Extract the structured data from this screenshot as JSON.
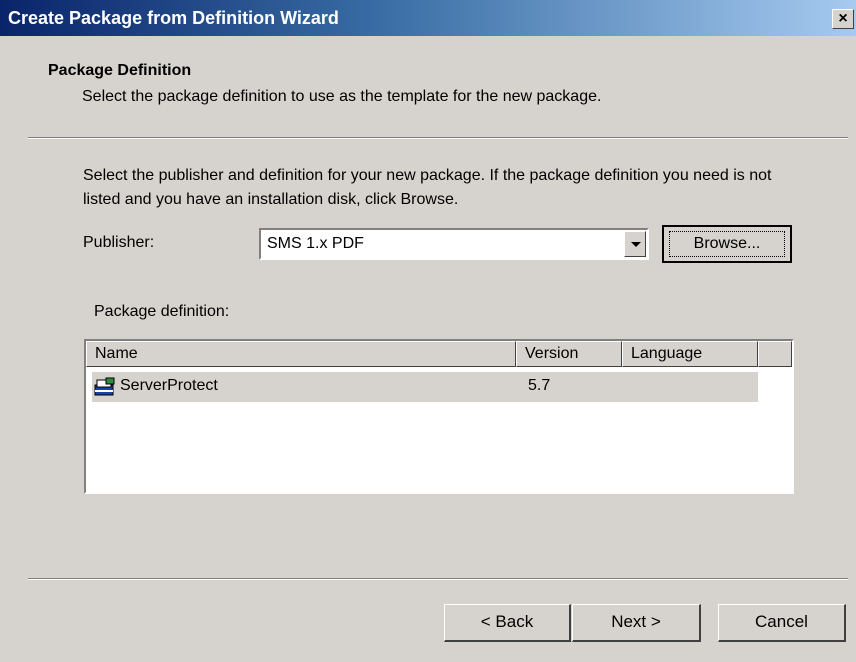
{
  "window": {
    "title": "Create Package from Definition Wizard",
    "close_label": "×"
  },
  "header": {
    "title": "Package Definition",
    "description": "Select the package definition to use as the template for the new package."
  },
  "instructions": "Select the publisher and definition for your new package. If the package definition you need is not listed and you have an installation disk, click Browse.",
  "publisher": {
    "label": "Publisher:",
    "value": "SMS 1.x PDF"
  },
  "browse_button": "Browse...",
  "package_definition": {
    "label": "Package definition:",
    "columns": [
      "Name",
      "Version",
      "Language"
    ],
    "rows": [
      {
        "name": "ServerProtect",
        "version": "5.7",
        "language": ""
      }
    ]
  },
  "buttons": {
    "back": "< Back",
    "next": "Next >",
    "cancel": "Cancel"
  },
  "icons": {
    "package_row_icon": "package-icon",
    "combo_arrow": "chevron-down-icon",
    "close": "close-icon"
  },
  "colors": {
    "title_bar_start": "#0a246a",
    "title_bar_end": "#a6caf0",
    "face": "#d6d3ce"
  }
}
